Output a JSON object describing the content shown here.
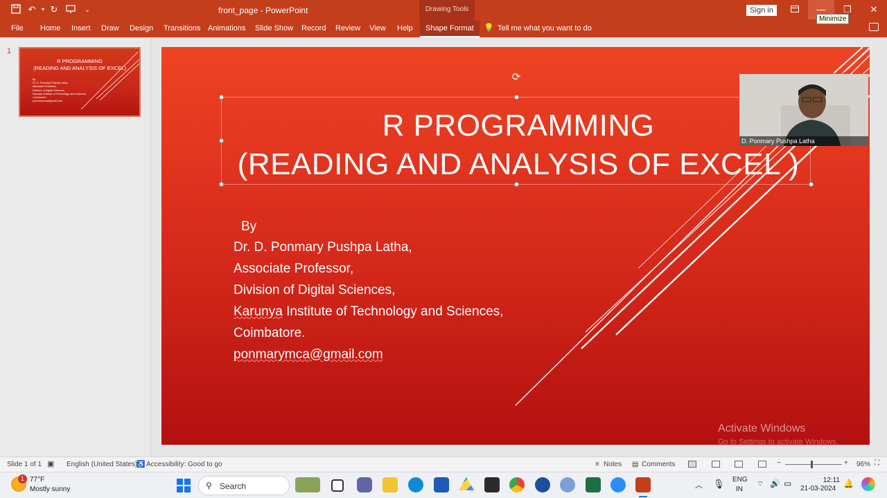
{
  "titlebar": {
    "doc_title": "front_page  -  PowerPoint",
    "drawing_tools": "Drawing Tools",
    "sign_in": "Sign in",
    "tooltip": "Minimize"
  },
  "ribbon": {
    "tabs": [
      "File",
      "Home",
      "Insert",
      "Draw",
      "Design",
      "Transitions",
      "Animations",
      "Slide Show",
      "Record",
      "Review",
      "View",
      "Help"
    ],
    "active_tab": "Shape Format",
    "tell_me": "Tell me what you want to do"
  },
  "thumbnails": {
    "number": "1",
    "title": "R PROGRAMMING\n(READING AND ANALYSIS OF EXCEL)",
    "body": "By\nDr. D. Ponmary Pushpa Latha,\nAssociate Professor,\nDivision of Digital Sciences,\nKarunya Institute of Technology and Sciences,\nCoimbatore.\nponmarymca@gmail.com"
  },
  "slide": {
    "title_line1": "R PROGRAMMING",
    "title_line2": "(READING AND ANALYSIS OF EXCEL )",
    "by": "By",
    "lines": [
      "Dr. D. Ponmary Pushpa Latha,",
      "Associate Professor,",
      "Division of Digital Sciences,",
      "Institute of Technology and Sciences,",
      "Coimbatore."
    ],
    "karunya": "Karunya",
    "email": "ponmarymca@gmail.com",
    "watermark_title": "Activate Windows",
    "watermark_sub": "Go to Settings to activate Windows."
  },
  "video": {
    "name": "D. Ponmary Pushpa Latha"
  },
  "statusbar": {
    "slide_count": "Slide 1 of 1",
    "language": "English (United States)",
    "accessibility": "Accessibility: Good to go",
    "notes": "Notes",
    "comments": "Comments",
    "zoom": "96%"
  },
  "taskbar": {
    "weather_temp": "77°F",
    "weather_desc": "Mostly sunny",
    "weather_badge": "1",
    "search": "Search",
    "lang1": "ENG",
    "lang2": "IN",
    "time": "12:11",
    "date": "21-03-2024"
  },
  "colors": {
    "accent": "#c43e1c",
    "slide_top": "#ef4324",
    "slide_bottom": "#b31010"
  }
}
